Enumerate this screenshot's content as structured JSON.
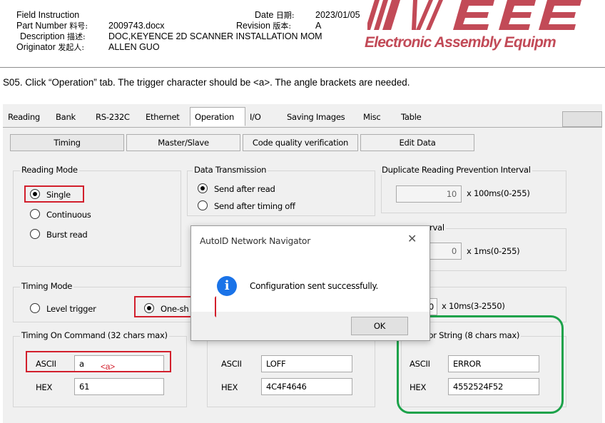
{
  "doc": {
    "field_instruction": "Field Instruction",
    "part_number_label": "Part Number",
    "part_number_cjk": "料号:",
    "part_number": "2009743.docx",
    "description_label": "Description",
    "description_cjk": "描述:",
    "description": "DOC,KEYENCE 2D SCANNER INSTALLATION MOM",
    "originator_label": "Originator",
    "originator_cjk": "发起人:",
    "originator": "ALLEN GUO",
    "date_label": "Date",
    "date_cjk": "日期:",
    "date": "2023/01/05",
    "revision_label": "Revision",
    "revision_cjk": "版本:",
    "revision": "A",
    "logo_marks": "ITW EAE",
    "logo_text": "Electronic Assembly Equipm",
    "brand_color": "#c24a57"
  },
  "step": "S05. Click “Operation” tab. The trigger character should be <a>. The angle brackets are needed.",
  "tabs": [
    "Reading",
    "Bank",
    "RS-232C",
    "Ethernet",
    "Operation",
    "I/O",
    "Saving Images",
    "Misc",
    "Table"
  ],
  "subtabs": [
    "Timing",
    "Master/Slave",
    "Code quality verification",
    "Edit Data"
  ],
  "reading_mode": {
    "title": "Reading Mode",
    "options": [
      "Single",
      "Continuous",
      "Burst read"
    ],
    "selected": "Single"
  },
  "data_transmission": {
    "title": "Data Transmission",
    "options": [
      "Send after read",
      "Send after timing off"
    ],
    "selected": "Send after read"
  },
  "dup_prevention": {
    "title": "Duplicate Reading Prevention Interval",
    "value": "10",
    "unit": "x 100ms(0-255)"
  },
  "read_interval": {
    "title_partial": "rval",
    "value": "0",
    "unit": "x 1ms(0-255)"
  },
  "timing_mode": {
    "title": "Timing Mode",
    "options": [
      "Level trigger",
      "One-sh"
    ],
    "selected": "One-sh"
  },
  "timeout": {
    "value_partial": "0",
    "unit": "x 10ms(3-2550)"
  },
  "timing_on_command": {
    "title": "Timing On Command (32 chars max)",
    "ascii_label": "ASCII",
    "ascii_value": "a",
    "annotation": "<a>",
    "hex_label": "HEX",
    "hex_value": "61"
  },
  "timing_off_command": {
    "ascii_label": "ASCII",
    "ascii_value": "LOFF",
    "hex_label": "HEX",
    "hex_value": "4C4F4646"
  },
  "error_string": {
    "title": "Error String (8 chars max)",
    "ascii_label": "ASCII",
    "ascii_value": "ERROR",
    "hex_label": "HEX",
    "hex_value": "4552524F52"
  },
  "dialog": {
    "title": "AutoID Network Navigator",
    "message": "Configuration sent successfully.",
    "ok_label": "OK",
    "close_icon": "close-icon",
    "info_icon": "info-icon"
  },
  "colors": {
    "highlight_red": "#d21f2c",
    "highlight_green": "#1ca24a",
    "info_blue": "#1a73e8"
  }
}
